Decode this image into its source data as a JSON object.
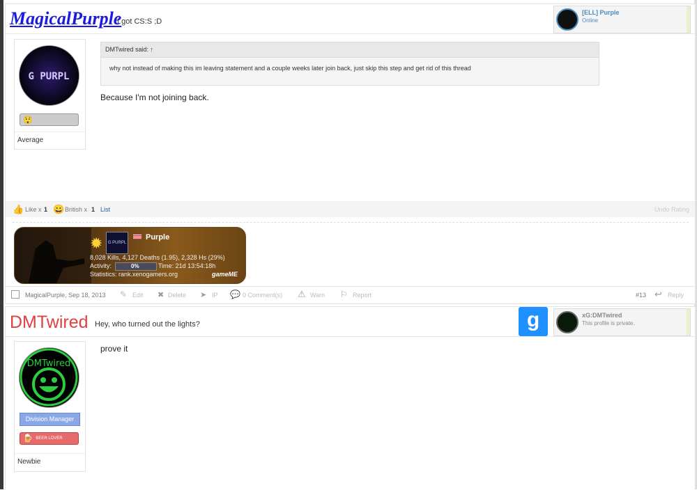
{
  "posts": [
    {
      "username": "MagicalPurple",
      "user_title": "I got CS:S ;D",
      "steam_name": "[ELL] Purple",
      "steam_status": "Online",
      "avatar_text": "G PURPL",
      "rank": "Average",
      "quote_author": "DMTwired said: ↑",
      "quote_text": "why not instead of making this im leaving statement and a couple weeks later join back, just skip this step and get rid of this thread",
      "message": "Because I'm not joining back.",
      "likes": {
        "like_label": "Like x",
        "like_count": "1",
        "british_label": "British x",
        "british_count": "1",
        "list_label": "List",
        "undo_label": "Undo Rating"
      },
      "signature": {
        "player_name": "Purple",
        "avatar_text": "G PURPL",
        "stats_line": "8,028 Kills, 4,127 Deaths (1.95), 2,328 Hs (29%)",
        "activity_label": "Activity:",
        "activity_value": "0%",
        "time_label": "Time: 21d 13:54:18h",
        "stats_site": "Statistics: rank.xenogamers.org",
        "brand": "gameME"
      },
      "footer": {
        "author_date": "MagicalPurple, Sep 18, 2013",
        "edit": "Edit",
        "delete": "Delete",
        "ip": "IP",
        "comments": "0 Comment(s)",
        "warn": "Warn",
        "report": "Report",
        "post_number": "#13",
        "reply": "Reply"
      }
    },
    {
      "username": "DMTwired",
      "user_title": "Hey, who turned out the lights?",
      "steam_name": "xG:DMTwired",
      "steam_status": "This profile is private.",
      "avatar_text": "DMTwired",
      "group": "Division Manager",
      "badge": "BEER LOVER",
      "rank": "Newbie",
      "message": "prove it",
      "gmod_letter": "g"
    }
  ],
  "colors": {
    "link_blue": "#1a1ae0",
    "name_red": "#e04040",
    "steam_blue": "#4a8ac0",
    "gmod_blue": "#1e90ff"
  }
}
